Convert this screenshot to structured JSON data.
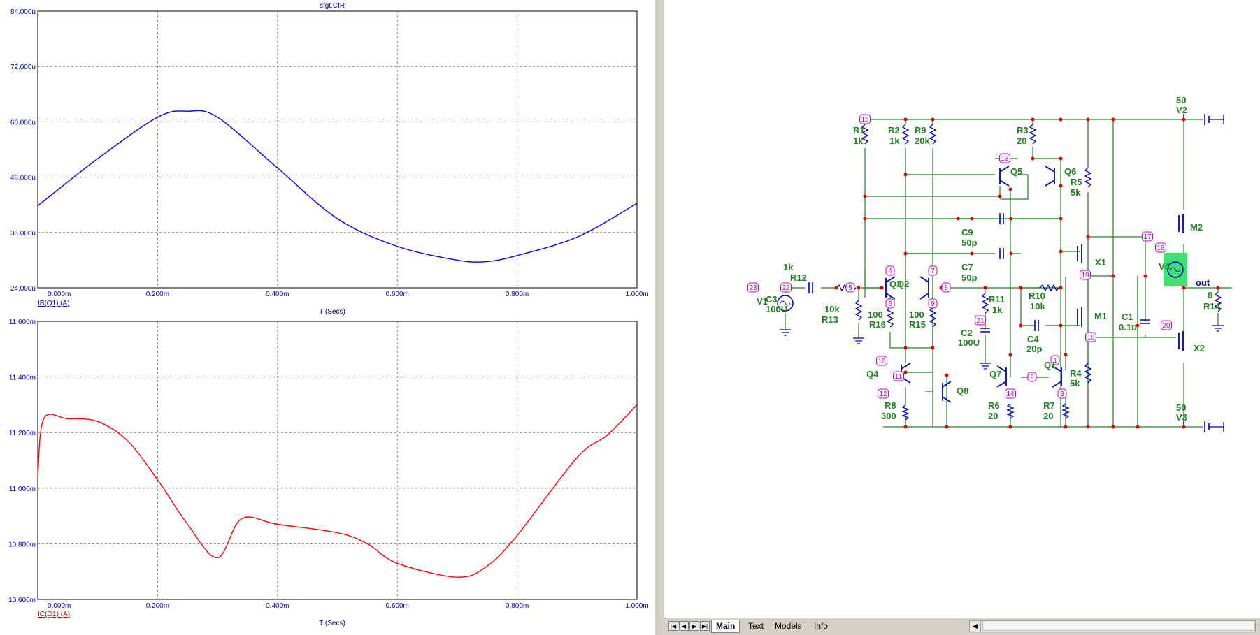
{
  "plot": {
    "title": "sfgt.CIR",
    "top": {
      "y_ticks": [
        "84.000u",
        "72.000u",
        "60.000u",
        "48.000u",
        "36.000u",
        "24.000u"
      ],
      "x_ticks": [
        "0.000m",
        "0.200m",
        "0.400m",
        "0.600m",
        "0.800m",
        "1.000m"
      ],
      "trace_label": "IB(Q1) (A)",
      "x_axis_label": "T (Secs)",
      "color": "#0000ff"
    },
    "bottom": {
      "y_ticks": [
        "11.600m",
        "11.400m",
        "11.200m",
        "11.000m",
        "10.800m",
        "10.600m"
      ],
      "x_ticks": [
        "0.000m",
        "0.200m",
        "0.400m",
        "0.600m",
        "0.800m",
        "1.000m"
      ],
      "trace_label": "IC(Q1) (A)",
      "x_axis_label": "T (Secs)",
      "color": "#ff0000"
    }
  },
  "chart_data": [
    {
      "type": "line",
      "title": "sfgt.CIR",
      "xlabel": "T (Secs)",
      "ylabel": "",
      "xlim": [
        0,
        0.001
      ],
      "ylim": [
        2.4e-05,
        8.4e-05
      ],
      "grid": true,
      "series": [
        {
          "name": "IB(Q1) (A)",
          "x": [
            0,
            0.0001,
            0.0002,
            0.00025,
            0.0003,
            0.0004,
            0.0005,
            0.0006,
            0.0007,
            0.00075,
            0.0008,
            0.0009,
            0.001
          ],
          "y": [
            4.18e-05,
            5.2e-05,
            6.1e-05,
            6.23e-05,
            6.1e-05,
            5e-05,
            3.9e-05,
            3.3e-05,
            3e-05,
            2.97e-05,
            3.1e-05,
            3.5e-05,
            4.23e-05
          ]
        }
      ]
    },
    {
      "type": "line",
      "title": "",
      "xlabel": "T (Secs)",
      "ylabel": "",
      "xlim": [
        0,
        0.001
      ],
      "ylim": [
        0.0106,
        0.0116
      ],
      "grid": true,
      "series": [
        {
          "name": "IC(Q1) (A)",
          "x": [
            0,
            1e-05,
            5e-05,
            0.0001,
            0.00015,
            0.0002,
            0.00025,
            0.0003,
            0.00034,
            0.0004,
            0.0005,
            0.00055,
            0.0006,
            0.0007,
            0.00075,
            0.0008,
            0.0009,
            0.00095,
            0.001
          ],
          "y": [
            0.01104,
            0.01125,
            0.01125,
            0.01124,
            0.01117,
            0.01103,
            0.01087,
            0.01075,
            0.01089,
            0.01087,
            0.01084,
            0.0108,
            0.01073,
            0.01068,
            0.01072,
            0.01083,
            0.01111,
            0.01119,
            0.0113
          ]
        }
      ]
    }
  ],
  "schematic": {
    "components": {
      "R1": [
        "R1",
        "1k"
      ],
      "R2": [
        "R2",
        "1k"
      ],
      "R9": [
        "R9",
        "20k"
      ],
      "R3": [
        "R3",
        "20"
      ],
      "R5": [
        "R5",
        "5k"
      ],
      "R12": [
        "1k",
        "R12"
      ],
      "C3": [
        "C3",
        "100U"
      ],
      "R13": [
        "10k",
        "R13"
      ],
      "R16": [
        "100",
        "R16"
      ],
      "R15": [
        "100",
        "R15"
      ],
      "C9": [
        "C9",
        "50p"
      ],
      "C7": [
        "C7",
        "50p"
      ],
      "R11": [
        "R11",
        "1k"
      ],
      "C2": [
        "C2",
        "100U"
      ],
      "R10": [
        "R10",
        "10k"
      ],
      "C4": [
        "C4",
        "20p"
      ],
      "C1": [
        "C1",
        "0.1u"
      ],
      "R4": [
        "R4",
        "5k"
      ],
      "R8": [
        "R8",
        "300"
      ],
      "R6": [
        "R6",
        "20"
      ],
      "R7": [
        "R7",
        "20"
      ],
      "V2": [
        "50",
        "V2"
      ],
      "V3": [
        "50",
        "V3"
      ],
      "R14": [
        "8",
        "R14"
      ]
    },
    "devices": [
      "V1",
      "Q2",
      "Q3",
      "Q4",
      "Q8",
      "Q5",
      "Q6",
      "Q7",
      "Q1",
      "X1",
      "M1",
      "M2",
      "X2",
      "V4"
    ],
    "out_label": "out",
    "nodes": [
      "15",
      "13",
      "4",
      "7",
      "5",
      "6",
      "9",
      "8",
      "23",
      "22",
      "10",
      "11",
      "12",
      "21",
      "14",
      "2",
      "1",
      "3",
      "17",
      "18",
      "19",
      "16",
      "20"
    ]
  },
  "tabs": [
    "Main",
    "Text",
    "Models",
    "Info"
  ],
  "active_tab": "Main",
  "nav_buttons": [
    "|◀",
    "◀",
    "▶",
    "▶|"
  ]
}
